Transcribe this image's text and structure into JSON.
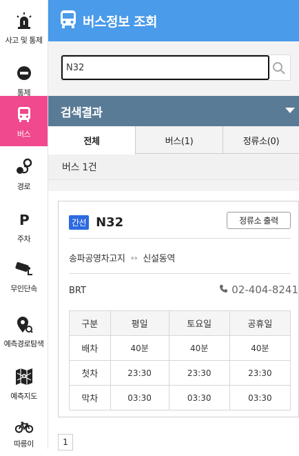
{
  "sidebar": {
    "items": [
      {
        "label": "사고 및 통제",
        "icon": "accident-alert-icon"
      },
      {
        "label": "통제",
        "icon": "no-entry-icon"
      },
      {
        "label": "버스",
        "icon": "bus-icon",
        "active": true
      },
      {
        "label": "경로",
        "icon": "route-icon"
      },
      {
        "label": "주차",
        "icon": "parking-icon"
      },
      {
        "label": "무인단속",
        "icon": "speed-camera-icon"
      },
      {
        "label": "예측경로탐색",
        "icon": "predict-route-icon"
      },
      {
        "label": "예측지도",
        "icon": "predict-map-icon"
      },
      {
        "label": "따릉이",
        "icon": "bicycle-icon"
      }
    ]
  },
  "header": {
    "title": "버스정보 조회",
    "icon": "bus-icon"
  },
  "search": {
    "value": "N32",
    "icon": "search-icon"
  },
  "results": {
    "title": "검색결과"
  },
  "tabs": [
    {
      "label": "전체",
      "active": true
    },
    {
      "label": "버스(1)"
    },
    {
      "label": "정류소(0)"
    }
  ],
  "count_text": "버스 1건",
  "route": {
    "badge": "간선",
    "number": "N32",
    "print_label": "정류소 출력",
    "from": "송파공영차고지",
    "arrow": "↔",
    "to": "신설동역",
    "company": "BRT",
    "phone": "02-404-8241"
  },
  "schedule": {
    "headers": [
      "구분",
      "평일",
      "토요일",
      "공휴일"
    ],
    "rows": [
      [
        "배차",
        "40분",
        "40분",
        "40분"
      ],
      [
        "첫차",
        "23:30",
        "23:30",
        "23:30"
      ],
      [
        "막차",
        "03:30",
        "03:30",
        "03:30"
      ]
    ]
  },
  "pagination": {
    "current": "1"
  },
  "colors": {
    "header": "#4a9bea",
    "active_nav": "#f0498d",
    "results_bar": "#5a7b96",
    "badge": "#2d6ae0"
  }
}
